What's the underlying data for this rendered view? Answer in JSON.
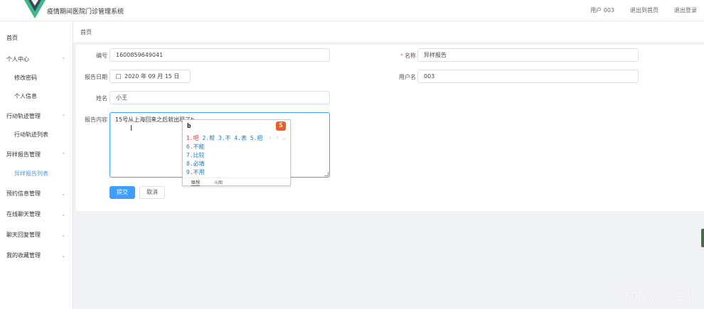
{
  "header": {
    "app_title": "疫情期间医院门诊管理系统",
    "user_label": "用户 003",
    "back_home": "退出到首页",
    "logout": "退出登录"
  },
  "sidebar": {
    "items": [
      {
        "label": "首页",
        "arrow": ""
      },
      {
        "label": "个人中心",
        "arrow": "⌃"
      },
      {
        "label": "修改密码",
        "arrow": ""
      },
      {
        "label": "个人信息",
        "arrow": ""
      },
      {
        "label": "行动轨迹管理",
        "arrow": "⌃"
      },
      {
        "label": "行动轨迹列表",
        "arrow": ""
      },
      {
        "label": "异样报告管理",
        "arrow": "⌃"
      },
      {
        "label": "异样报告列表",
        "arrow": ""
      },
      {
        "label": "预约信息管理",
        "arrow": "⌄"
      },
      {
        "label": "在线聊天管理",
        "arrow": "⌄"
      },
      {
        "label": "聊天回复管理",
        "arrow": "⌄"
      },
      {
        "label": "我的收藏管理",
        "arrow": "⌄"
      }
    ]
  },
  "breadcrumb": "首页",
  "form": {
    "id_label": "编号",
    "id_value": "1600859649041",
    "name_label": "名称",
    "name_required": "*",
    "name_value": "异样报告",
    "date_label": "报告日期",
    "date_value": "2020 年 09 月 15 日",
    "username_label": "用户名",
    "username_value": "003",
    "person_label": "姓名",
    "person_value": "小王",
    "content_label": "报告内容",
    "content_value": "15号从上海回来之后就出现了b",
    "submit": "提交",
    "cancel": "取消"
  },
  "ime": {
    "input": "b",
    "logo": "S",
    "row1_first": "1.吧",
    "row1_rest": " 2.帮 3.不 4.表 5.把",
    "nav": "‹ › ⌄",
    "candidates": [
      "6.不能",
      "7.比较",
      "8.必填",
      "9.不用"
    ],
    "tabs": [
      "联想",
      "斗图"
    ]
  },
  "watermark": "CSDN @小助手AI",
  "colors": {
    "primary": "#409eff",
    "required": "#f56c6c",
    "ime_brand": "#ef5b2b"
  }
}
